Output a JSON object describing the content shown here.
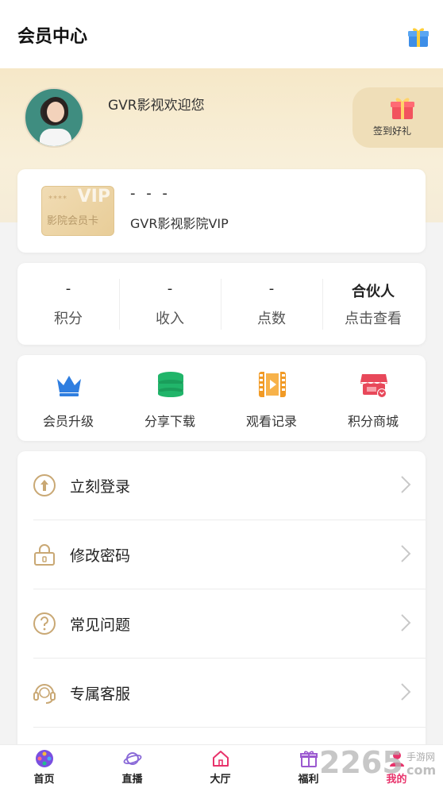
{
  "header": {
    "title": "会员中心",
    "icon": "gift-box-icon"
  },
  "profile": {
    "welcome": "GVR影视欢迎您",
    "checkin_label": "签到好礼",
    "checkin_icon": "gift-icon"
  },
  "vip_card": {
    "badge_stars": "****",
    "badge_vip": "VIP",
    "badge_name": "影院会员卡",
    "status": "- - -",
    "plan": "GVR影视影院VIP"
  },
  "stats": [
    {
      "value": "-",
      "label": "积分"
    },
    {
      "value": "-",
      "label": "收入"
    },
    {
      "value": "-",
      "label": "点数"
    },
    {
      "value": "合伙人",
      "label": "点击查看"
    }
  ],
  "shortcuts": [
    {
      "label": "会员升级",
      "icon": "crown-icon",
      "color": "#2f7ee0"
    },
    {
      "label": "分享下载",
      "icon": "database-icon",
      "color": "#21b56a"
    },
    {
      "label": "观看记录",
      "icon": "film-icon",
      "color": "#f19a25"
    },
    {
      "label": "积分商城",
      "icon": "store-icon",
      "color": "#e8485a"
    }
  ],
  "menu": [
    {
      "label": "立刻登录",
      "icon": "upload-circle-icon"
    },
    {
      "label": "修改密码",
      "icon": "lock-icon"
    },
    {
      "label": "常见问题",
      "icon": "question-circle-icon"
    },
    {
      "label": "专属客服",
      "icon": "headset-icon"
    }
  ],
  "tabs": [
    {
      "label": "首页",
      "icon": "film-reel-icon"
    },
    {
      "label": "直播",
      "icon": "planet-icon"
    },
    {
      "label": "大厅",
      "icon": "home-icon"
    },
    {
      "label": "福利",
      "icon": "gift-icon"
    },
    {
      "label": "我的",
      "icon": "user-icon",
      "active": true
    }
  ],
  "watermark": {
    "brand": "2265",
    "site": "手游网",
    "domain": "com"
  },
  "colors": {
    "accent": "#e8336b",
    "gold": "#c9a874",
    "banner": "#f6e8c8"
  }
}
